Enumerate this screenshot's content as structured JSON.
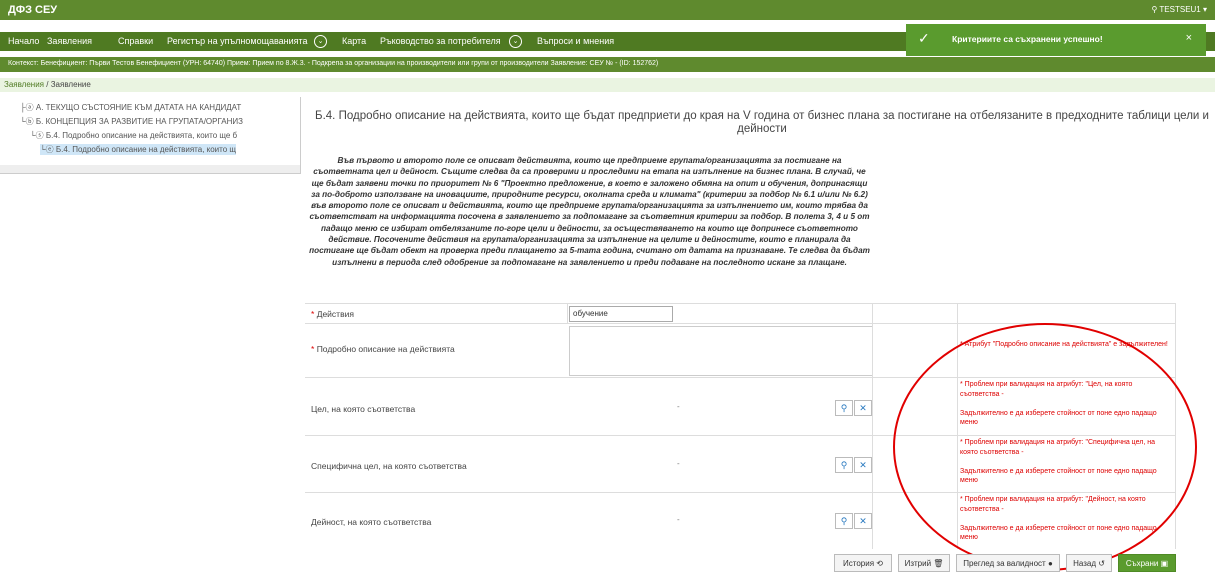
{
  "app": {
    "title": "ДФЗ СЕУ",
    "user": "TESTSEU1"
  },
  "nav": {
    "items": [
      "Начало",
      "Заявления",
      "Справки",
      "Регистър на упълномощаванията",
      "Карта",
      "Ръководство за потребителя",
      "Въпроси и мнения"
    ]
  },
  "context": {
    "text": "Контекст: Бенефициент: Първи Тестов Бенефициент (УРН: 64740) Прием: Прием по 8.Ж.3. - Подкрепа за организации на производители или групи от производители Заявление: СЕУ № - (ID: 152762)"
  },
  "breadcrumb": {
    "first": "Заявления",
    "sep": "/",
    "current": "Заявление"
  },
  "toast": {
    "message": "Критериите са съхранени успешно!",
    "close": "×"
  },
  "tree": {
    "items": [
      "А. ТЕКУЩО СЪСТОЯНИЕ КЪМ ДАТАТА НА КАНДИДАТ",
      "Б. КОНЦЕПЦИЯ ЗА РАЗВИТИЕ НА ГРУПАТА/ОРГАНИЗ",
      "Б.4. Подробно описание на действията, които ще б",
      "Б.4. Подробно описание на действията, които щ"
    ]
  },
  "form": {
    "title": "Б.4. Подробно описание на действията, които ще бъдат предприети до края на V година от бизнес плана за постигане на отбелязаните в предходните таблици цели и дейности",
    "intro": "Във първото и второто поле се описват действията, които ще предприеме групата/организацията за постигане на съответната цел и дейност. Същите следва да са проверими и проследими на етапа на изпълнение на бизнес плана. В случай, че ще бъдат заявени точки по приоритет № 6 \"Проектно предложение, в което е заложено обмяна на опит и обучения, допринасящи за по-доброто използване на иновациите, природните ресурси, околната среда и климата\" (критерии за подбор № 6.1 и/или № 6.2) във второто поле се описват и действията, които ще предприеме групата/организацията за изпълнението им, които трябва да съответстват на информацията посочена в заявлението за подпомагане за съответния критерии за подбор. В полета 3, 4 и 5 от падащо меню се избират отбелязаните по-горе цели и дейности, за осъществяването на които ще допринесе съответното действие. Посочените действия на групата/организацията за изпълнение на целите и дейностите, които е планирала да постигане ще бъдат обект на проверка преди плащането за 5-тата година, считано от датата на признаване. Те следва да бъдат изпълнени в периода след одобрение за подпомагане на заявлението и преди подаване на последното искане за плащане.",
    "fields": {
      "actions": {
        "label": "Действия",
        "value": "обучение",
        "required": "*"
      },
      "description": {
        "label": "Подробно описание на действията",
        "required": "*",
        "error": "* Атрибут \"Подробно описание на действията\" е задължителен!"
      },
      "goal": {
        "label": "Цел, на която съответства",
        "value": "-",
        "error1": "* Проблем при валидация на атрибут: \"Цел, на която съответства -",
        "error2": "Задължително е да изберете стойност от поне едно падащо меню"
      },
      "specific_goal": {
        "label": "Специфична цел, на която съответства",
        "value": "-",
        "error1": "* Проблем при валидация на атрибут: \"Специфична цел, на която съответства -",
        "error2": "Задължително е да изберете стойност от поне едно падащо меню"
      },
      "activity": {
        "label": "Дейност, на която съответства",
        "value": "-",
        "error1": "* Проблем при валидация на атрибут: \"Дейност, на която съответства -",
        "error2": "Задължително е да изберете стойност от поне едно падащо меню"
      }
    }
  },
  "buttons": {
    "history": "История",
    "delete": "Изтрий",
    "validate": "Преглед за валидност",
    "back": "Назад",
    "save": "Съхрани"
  },
  "colors": {
    "header": "#5f8a2e",
    "nav": "#4f7a22",
    "toast": "#5a9b2e",
    "error": "#dd0000",
    "annotation": "#e10000"
  }
}
